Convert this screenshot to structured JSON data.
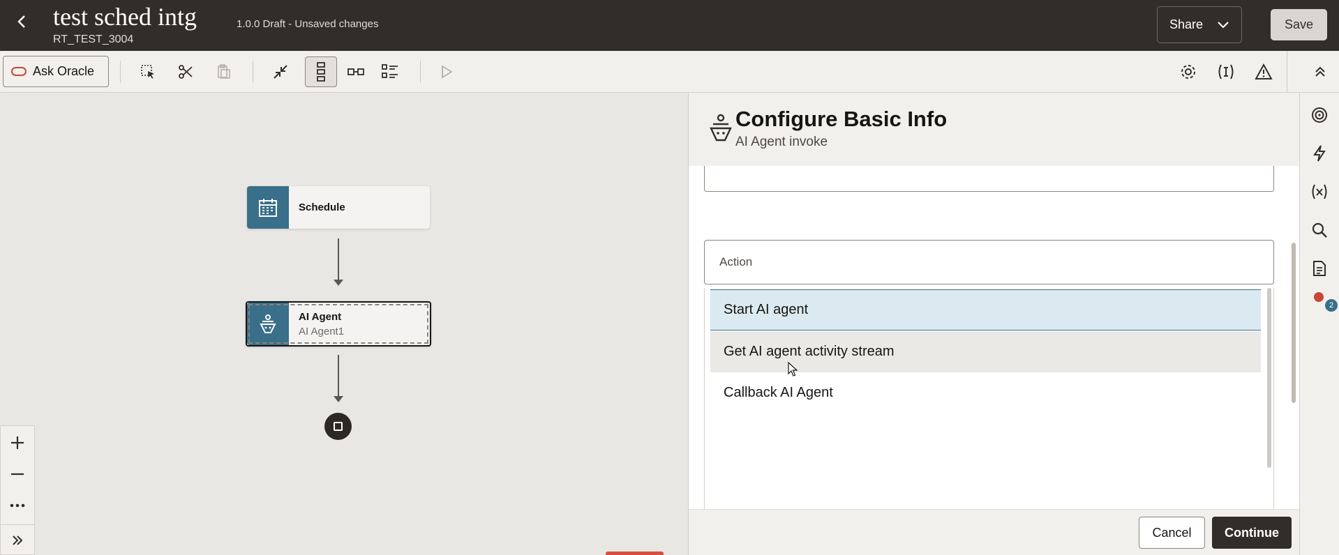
{
  "header": {
    "title": "test sched intg",
    "subtitle": "RT_TEST_3004",
    "status": "1.0.0 Draft - Unsaved changes",
    "share_label": "Share",
    "save_label": "Save"
  },
  "toolbar": {
    "ask_oracle_label": "Ask Oracle",
    "icons": [
      "select-icon",
      "cut-icon",
      "paste-icon",
      "collapse-icon",
      "vertical-layout-icon",
      "horizontal-layout-icon",
      "list-layout-icon",
      "run-icon",
      "settings-icon",
      "variables-icon",
      "warning-icon",
      "collapse-up-icon"
    ]
  },
  "canvas": {
    "nodes": [
      {
        "title": "Schedule",
        "subtitle": ""
      },
      {
        "title": "AI Agent",
        "subtitle": "AI Agent1"
      }
    ],
    "zoom_controls": [
      "zoom-in-icon",
      "zoom-out-icon",
      "more-icon",
      "expand-icon"
    ]
  },
  "panel": {
    "title": "Configure Basic Info",
    "subtitle": "AI Agent invoke",
    "action_label": "Action",
    "options": [
      "Start AI agent",
      "Get AI agent activity stream",
      "Callback AI Agent"
    ],
    "selected_option": "Start AI agent",
    "cancel_label": "Cancel",
    "continue_label": "Continue"
  },
  "rail": {
    "icons": [
      "target-icon",
      "lightning-icon",
      "variable-icon",
      "search-icon",
      "document-icon",
      "notifications-icon"
    ],
    "badge_count": "2"
  },
  "colors": {
    "header_bg": "#312d2a",
    "node_accent": "#3a6f8a",
    "selected_bg": "#dbeaf0",
    "oracle_red": "#c74634"
  }
}
